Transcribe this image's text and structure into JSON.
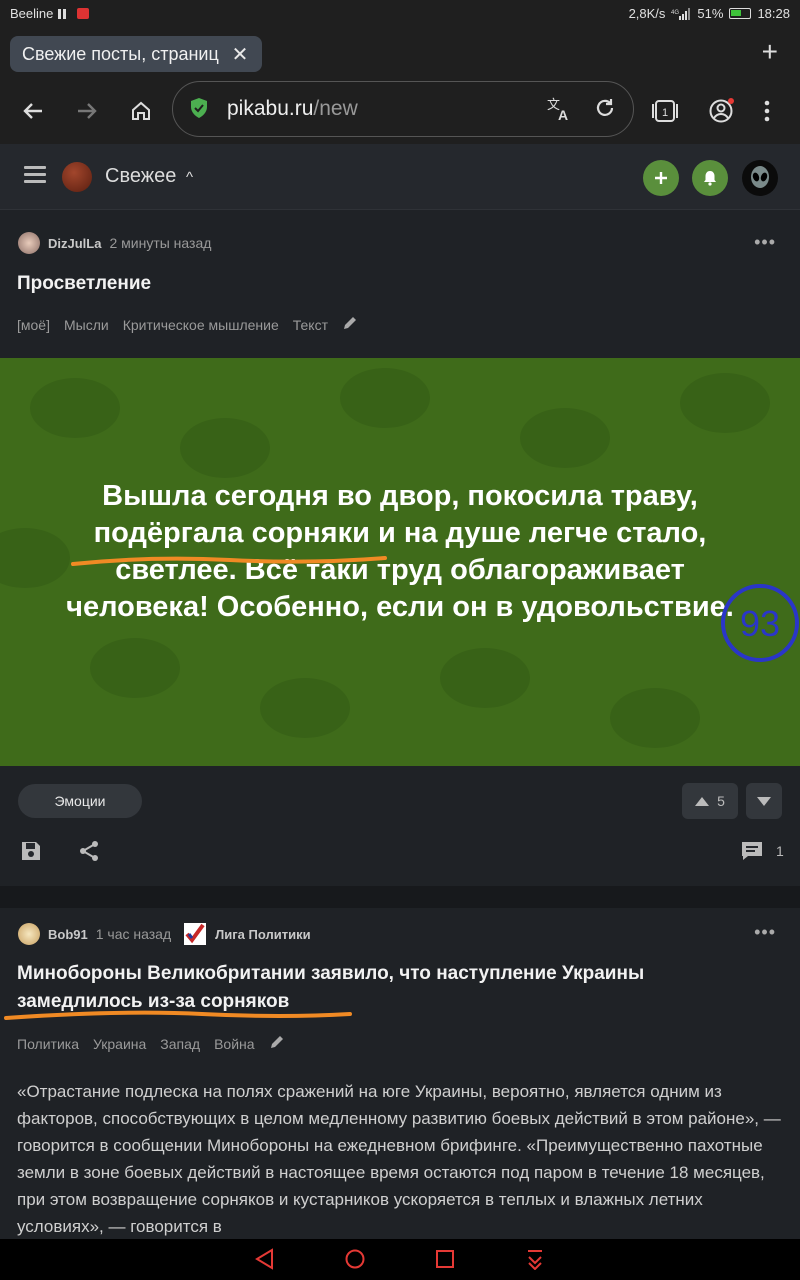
{
  "status_bar": {
    "carrier": "Beeline",
    "speed": "2,8K/s",
    "battery": "51%",
    "time": "18:28"
  },
  "browser": {
    "tab_title": "Свежие посты, страниц",
    "url_host": "pikabu.ru",
    "url_path": "/new",
    "tabs_count": "1"
  },
  "site_header": {
    "title": "Свежее",
    "accent_green": "#5a8f3c",
    "icons": [
      "menu-icon",
      "plus-icon",
      "bell-icon",
      "alien-avatar"
    ]
  },
  "post1": {
    "author": "DizJulLa",
    "time": "2 минуты назад",
    "title": "Просветление",
    "tags": [
      "[моё]",
      "Мысли",
      "Критическое мышление",
      "Текст"
    ],
    "image_text": "Вышла сегодня во двор, покосила траву, подёргала сорняки и на душе легче стало, светлее. Всё таки труд облагораживает человека! Особенно, если он в удовольствие.",
    "badge_number": "93",
    "emotions_label": "Эмоции",
    "rating": "5",
    "comments": "1"
  },
  "post2": {
    "author": "Bob91",
    "time": "1 час назад",
    "community": "Лига Политики",
    "title": "Минобороны Великобритании заявило, что наступление Украины замедлилось из-за сорняков",
    "tags": [
      "Политика",
      "Украина",
      "Запад",
      "Война"
    ],
    "body": "«Отрастание подлеска на полях сражений на юге Украины, вероятно, является одним из факторов, способствующих в целом медленному развитию боевых действий в этом районе», — говорится в сообщении Минобороны на ежедневном брифинге. «Преимущественно пахотные земли в зоне боевых действий в настоящее время остаются под паром в течение 18 месяцев, при этом возвращение сорняков и кустарников ускоряется в теплых и влажных летних условиях», — говорится в"
  }
}
